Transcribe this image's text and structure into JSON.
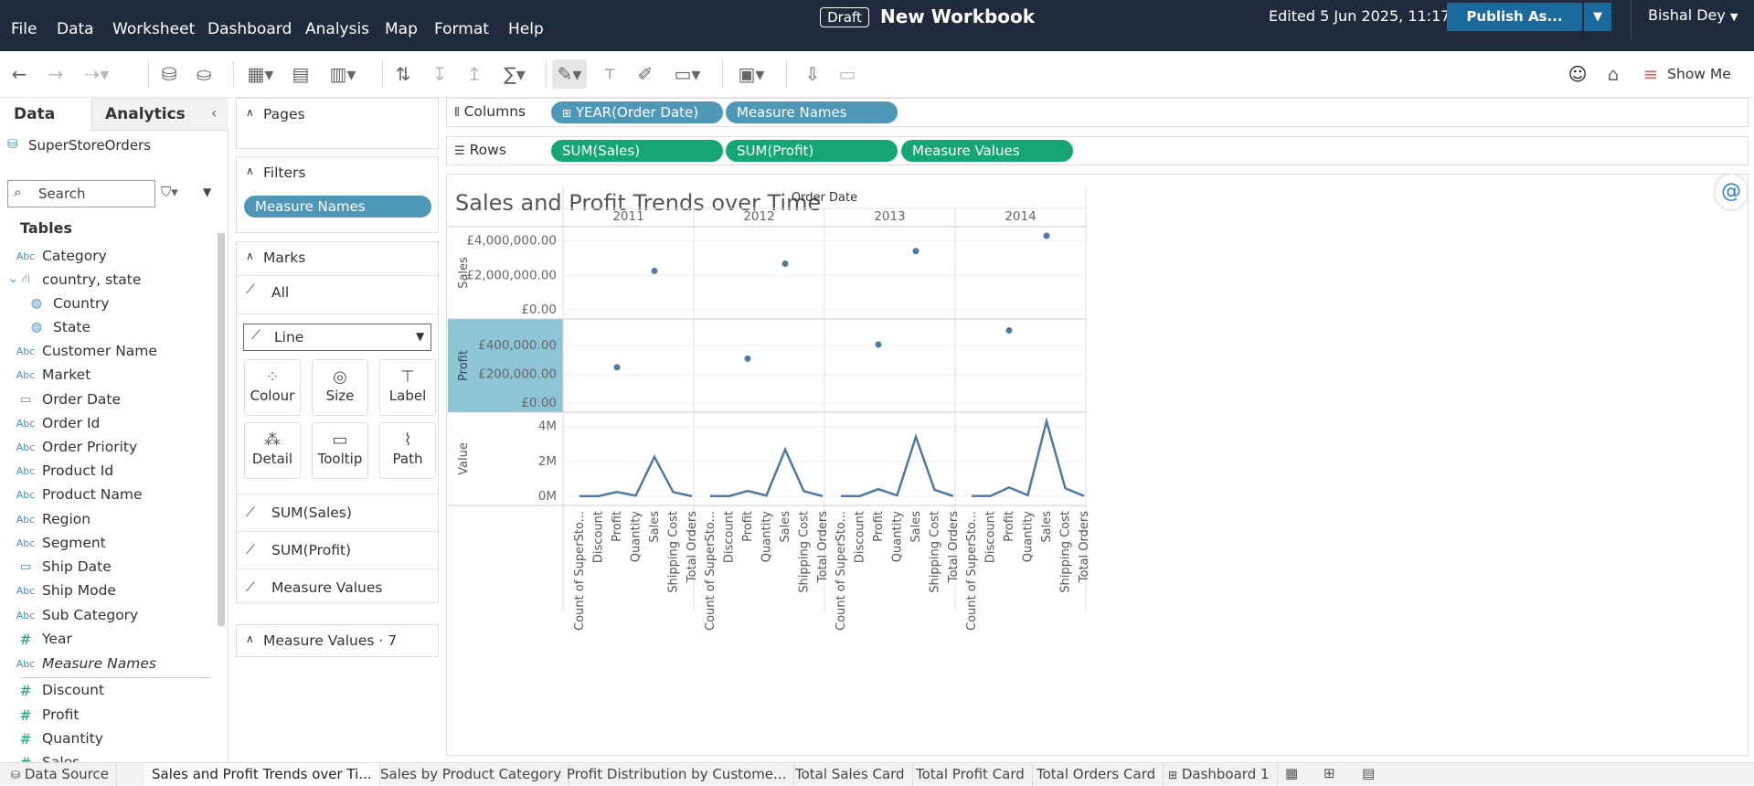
{
  "menu": [
    "File",
    "Data",
    "Worksheet",
    "Dashboard",
    "Analysis",
    "Map",
    "Format",
    "Help"
  ],
  "header": {
    "draft": "Draft",
    "title": "New Workbook",
    "edited": "Edited 5 Jun 2025, 11:17",
    "publish": "Publish As...",
    "user": "Bishal Dey"
  },
  "toolbar": {
    "show_me": "Show Me"
  },
  "datapane": {
    "tab_data": "Data",
    "tab_analytics": "Analytics",
    "datasource": "SuperStoreOrders",
    "search_placeholder": "Search",
    "tables_label": "Tables",
    "fields": [
      {
        "icon": "Abc",
        "name": "Category"
      },
      {
        "icon": "hier",
        "name": "country, state"
      },
      {
        "icon": "geo",
        "name": "Country"
      },
      {
        "icon": "geo",
        "name": "State"
      },
      {
        "icon": "Abc",
        "name": "Customer Name"
      },
      {
        "icon": "Abc",
        "name": "Market"
      },
      {
        "icon": "date",
        "name": "Order Date"
      },
      {
        "icon": "Abc",
        "name": "Order Id"
      },
      {
        "icon": "Abc",
        "name": "Order Priority"
      },
      {
        "icon": "Abc",
        "name": "Product Id"
      },
      {
        "icon": "Abc",
        "name": "Product Name"
      },
      {
        "icon": "Abc",
        "name": "Region"
      },
      {
        "icon": "Abc",
        "name": "Segment"
      },
      {
        "icon": "date",
        "name": "Ship Date"
      },
      {
        "icon": "Abc",
        "name": "Ship Mode"
      },
      {
        "icon": "Abc",
        "name": "Sub Category"
      },
      {
        "icon": "#",
        "name": "Year"
      },
      {
        "icon": "Abc",
        "name": "Measure Names"
      },
      {
        "icon": "#",
        "name": "Discount"
      },
      {
        "icon": "#",
        "name": "Profit"
      },
      {
        "icon": "#",
        "name": "Quantity"
      },
      {
        "icon": "#",
        "name": "Sales"
      }
    ]
  },
  "cards": {
    "pages": "Pages",
    "filters": "Filters",
    "filter_pill": "Measure Names",
    "marks": "Marks",
    "marks_all": "All",
    "mark_type": "Line",
    "mark_buttons": [
      "Colour",
      "Size",
      "Label",
      "Detail",
      "Tooltip",
      "Path"
    ],
    "mark_rows": [
      "SUM(Sales)",
      "SUM(Profit)",
      "Measure Values"
    ],
    "measure_values": "Measure Values · 7"
  },
  "shelves": {
    "columns_label": "Columns",
    "rows_label": "Rows",
    "columns": [
      "YEAR(Order Date)",
      "Measure Names"
    ],
    "rows": [
      "SUM(Sales)",
      "SUM(Profit)",
      "Measure Values"
    ]
  },
  "colors": {
    "accent": "#4e79a7",
    "pill_blue": "#4e97b7",
    "pill_green": "#16a673",
    "highlight": "#8ec5d6",
    "topbar": "#1f2a3c"
  },
  "chart_data": {
    "type": "line",
    "title": "Sales and Profit Trends over Time",
    "column_header": "Order Date",
    "years": [
      "2011",
      "2012",
      "2013",
      "2014"
    ],
    "measures": [
      "Count of SuperSto...",
      "Discount",
      "Profit",
      "Quantity",
      "Sales",
      "Shipping Cost",
      "Total Orders"
    ],
    "sales_panel": {
      "axis_title": "Sales",
      "ticks": [
        "£4,000,000.00",
        "£2,000,000.00",
        "£0.00"
      ],
      "ylim": [
        0,
        4300000
      ],
      "values": [
        2260000,
        2680000,
        3410000,
        4300000
      ]
    },
    "profit_panel": {
      "axis_title": "Profit",
      "ticks": [
        "£400,000.00",
        "£200,000.00",
        "£0.00"
      ],
      "ylim": [
        0,
        520000
      ],
      "values": [
        248000,
        308000,
        406000,
        504000
      ]
    },
    "value_panel": {
      "axis_title": "Value",
      "ticks": [
        "4M",
        "2M",
        "0M"
      ],
      "ylim": [
        0,
        4300000
      ],
      "series": [
        {
          "year": "2011",
          "values": [
            8000,
            5000,
            248000,
            32000,
            2260000,
            240000,
            8000
          ]
        },
        {
          "year": "2012",
          "values": [
            10000,
            6000,
            308000,
            39000,
            2680000,
            290000,
            10000
          ]
        },
        {
          "year": "2013",
          "values": [
            13000,
            8000,
            406000,
            49000,
            3410000,
            370000,
            13000
          ]
        },
        {
          "year": "2014",
          "values": [
            17000,
            10000,
            504000,
            63000,
            4300000,
            460000,
            17000
          ]
        }
      ]
    }
  },
  "sheets": [
    "Data Source",
    "Sales and Profit Trends over Ti...",
    "Sales by Product Category",
    "Profit Distribution by Custome...",
    "Total Sales Card",
    "Total Profit Card",
    "Total Orders Card",
    "Dashboard 1"
  ]
}
